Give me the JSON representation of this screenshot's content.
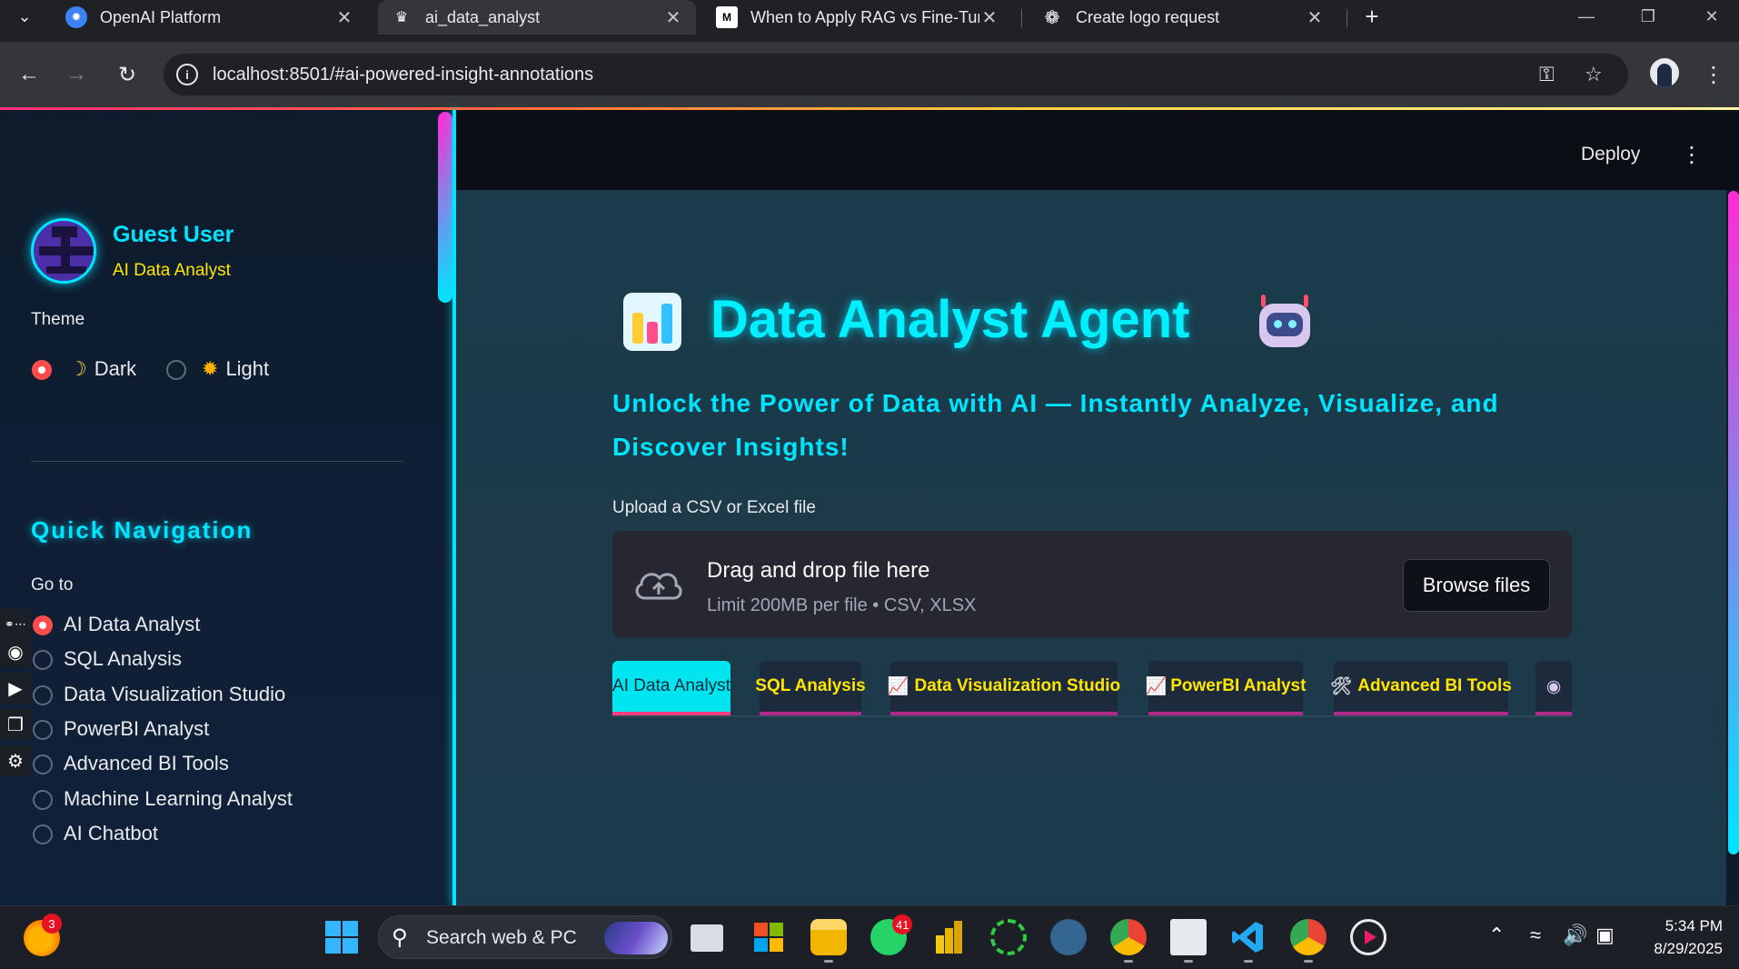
{
  "browser": {
    "tabs": [
      {
        "title": "OpenAI Platform",
        "icon": "openai-icon",
        "active": false
      },
      {
        "title": "ai_data_analyst",
        "icon": "streamlit-icon",
        "active": true
      },
      {
        "title": "When to Apply RAG vs Fine-Tur",
        "icon": "medium-icon",
        "active": false
      },
      {
        "title": "Create logo request",
        "icon": "chatgpt-icon",
        "active": false
      }
    ],
    "url": "localhost:8501/#ai-powered-insight-annotations"
  },
  "sidebar": {
    "user_name": "Guest User",
    "user_role": "AI Data Analyst",
    "theme_label": "Theme",
    "theme_options": [
      {
        "label": "Dark",
        "selected": true
      },
      {
        "label": "Light",
        "selected": false
      }
    ],
    "quick_nav_heading": "Quick Navigation",
    "goto_label": "Go to",
    "nav_items": [
      {
        "label": "AI Data Analyst",
        "selected": true
      },
      {
        "label": "SQL Analysis",
        "selected": false
      },
      {
        "label": "Data Visualization Studio",
        "selected": false
      },
      {
        "label": "PowerBI Analyst",
        "selected": false
      },
      {
        "label": "Advanced BI Tools",
        "selected": false
      },
      {
        "label": "Machine Learning Analyst",
        "selected": false
      },
      {
        "label": "AI Chatbot",
        "selected": false
      }
    ]
  },
  "header": {
    "deploy_label": "Deploy"
  },
  "main": {
    "title": "Data Analyst Agent",
    "subtitle": "Unlock the Power of Data with AI — Instantly Analyze, Visualize, and Discover Insights!",
    "upload_label": "Upload a CSV or Excel file",
    "dropzone_title": "Drag and drop file here",
    "dropzone_limit": "Limit 200MB per file • CSV, XLSX",
    "browse_label": "Browse files",
    "tabs": [
      {
        "label": "AI Data Analyst",
        "active": true
      },
      {
        "label": "SQL Analysis",
        "active": false
      },
      {
        "label": "Data Visualization Studio",
        "active": false
      },
      {
        "label": "PowerBI Analyst",
        "active": false
      },
      {
        "label": "Advanced BI Tools",
        "active": false
      }
    ]
  },
  "taskbar": {
    "search_placeholder": "Search web & PC",
    "weather_badge": "3",
    "whatsapp_badge": "41",
    "time": "5:34 PM",
    "date": "8/29/2025"
  },
  "colors": {
    "accent_cyan": "#00e5ff",
    "accent_yellow": "#ffe600",
    "radio_selected": "#ff4b4b",
    "main_bg": "#1a3b4a",
    "sidebar_bg": "#0e1b2c"
  }
}
